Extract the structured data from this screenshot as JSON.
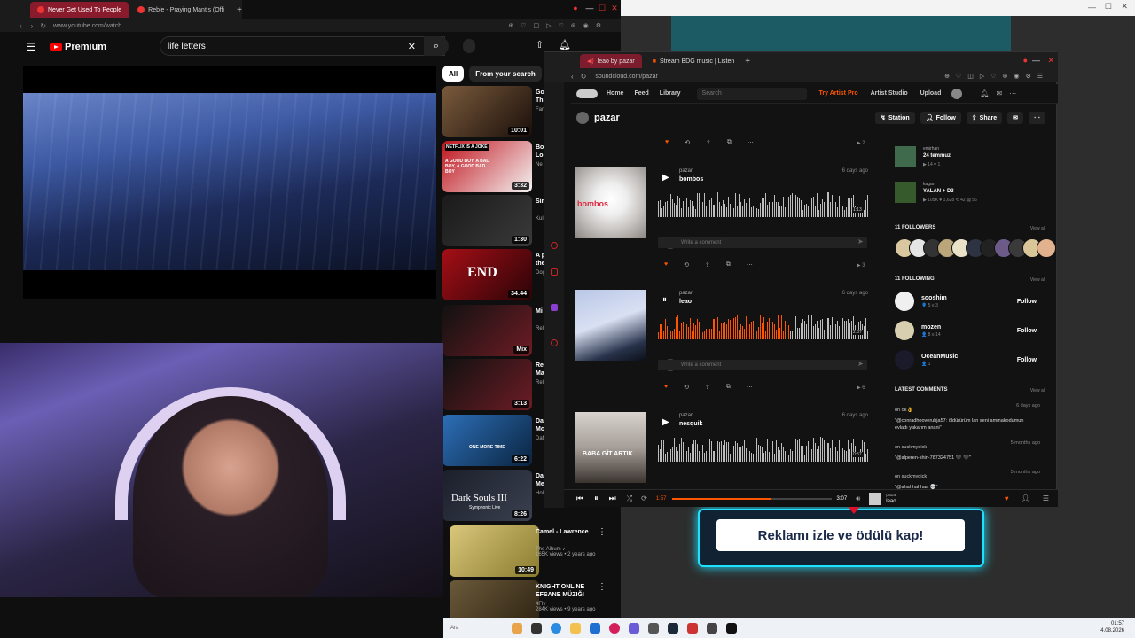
{
  "yt_browser": {
    "tabs": [
      "Never Get Used To People",
      "Reble - Praying Mantis (Offi"
    ],
    "url": "www.youtube.com/watch",
    "logo": "Premium",
    "search_value": "life letters",
    "chips": [
      "All",
      "From your search",
      "F"
    ],
    "recs": [
      {
        "title": "Go\nTh",
        "meta": "Far",
        "duration": "10:01",
        "thumb_colors": [
          "#7a5a3c",
          "#1a0f0a"
        ]
      },
      {
        "title": "Bo\nLo",
        "meta": "Ne",
        "duration": "3:32",
        "thumb_colors": [
          "#c0131c",
          "#f4f4f4"
        ]
      },
      {
        "title": "Sir",
        "meta": "Kul",
        "duration": "1:30",
        "thumb_colors": [
          "#1a1a1a",
          "#3a3a3a"
        ]
      },
      {
        "title": "A p\nthe",
        "meta": "Dog",
        "duration": "34:44",
        "thumb_colors": [
          "#a50e16",
          "#2a0407"
        ]
      },
      {
        "title": "Mi",
        "meta": "Rel",
        "duration": "Mix",
        "thumb_colors": [
          "#111",
          "#6d1c24"
        ]
      },
      {
        "title": "Re\nMa",
        "meta": "Rel",
        "duration": "3:13",
        "thumb_colors": [
          "#111",
          "#6d1c24"
        ]
      },
      {
        "title": "Da\nMo",
        "meta": "Daf",
        "duration": "6:22",
        "thumb_colors": [
          "#2d6fb8",
          "#0a2440"
        ]
      },
      {
        "title": "Da\nMe",
        "meta": "Hol",
        "duration": "8:26",
        "thumb_colors": [
          "#1b1f2a",
          "#3b4050"
        ]
      },
      {
        "title": "Camel - Lawrence",
        "meta": "The Album ♪\n165K views • 2 years ago",
        "duration": "10:49",
        "thumb_colors": [
          "#d9c77c",
          "#8a7b2d"
        ]
      },
      {
        "title": "KNIGHT ONLINE EFSANE MÜZIĞI",
        "meta": "4Fly\n284K views • 9 years ago",
        "duration": "",
        "thumb_colors": [
          "#6b5a3a",
          "#2b2010"
        ]
      }
    ],
    "thumb_text": {
      "r1": "END",
      "r6": "ONE MORE TIME",
      "r7": "Dark Souls III",
      "r7b": "Symphonic Live",
      "r1top": "NETFLIX IS A JOKE",
      "r1sub": "A GOOD BOY, A BAD BOY, A GOOD BAD BOY"
    }
  },
  "soundcloud": {
    "tabs": [
      "leao by pazar",
      "Stream BDG music | Listen"
    ],
    "url": "soundcloud.com/pazar",
    "nav": [
      "Home",
      "Feed",
      "Library"
    ],
    "search_placeholder": "Search",
    "try_pro": "Try Artist Pro",
    "artist_studio": "Artist Studio",
    "upload": "Upload",
    "profile_name": "pazar",
    "buttons": {
      "station": "Station",
      "follow": "Follow",
      "share": "Share"
    },
    "tracks": [
      {
        "user": "pazar",
        "title": "bombos",
        "ago": "6 days ago",
        "time": "1:13",
        "art_text": "bombos",
        "plays": "3"
      },
      {
        "user": "pazar",
        "title": "leao",
        "ago": "6 days ago",
        "time": "2:37",
        "elapsed": "1:57",
        "art_text": "",
        "plays": "6"
      },
      {
        "user": "pazar",
        "title": "nesquik",
        "ago": "6 days ago",
        "time": "0:57",
        "art_text": "BABA GİT ARTIK",
        "plays": ""
      }
    ],
    "top_plays": "2",
    "comment_placeholder": "Write a comment",
    "sidebar": {
      "reposts": [
        {
          "user": "emirhan",
          "title": "24 temmuz",
          "stats": "▶ 14 ♥ 1"
        },
        {
          "user": "kagan",
          "title": "YALAN + D3",
          "stats": "▶ 105K ♥ 1,628 ⟲ 42 ▤ 56"
        }
      ],
      "followers_h": "11 FOLLOWERS",
      "following_h": "11 FOLLOWING",
      "view_all": "View all",
      "following": [
        {
          "name": "sooshim",
          "stats": "👤 5  ≡ 3",
          "btn": "Follow"
        },
        {
          "name": "mozen",
          "stats": "👤 8  ≡ 14",
          "btn": "Follow"
        },
        {
          "name": "OceanMusic",
          "stats": "👤 1",
          "btn": "Follow"
        }
      ],
      "comments_h": "LATEST COMMENTS",
      "comments": [
        {
          "meta": "on ok👌",
          "ago": "6 days ago",
          "text": "\"@conradhooverubja57: öldürürüm lan seni amınakodumun evladı yakarım anani\""
        },
        {
          "meta": "on suckmydick",
          "ago": "5 months ago",
          "text": "\"@alperen-shin-787324751 🖤 🖤\""
        },
        {
          "meta": "on suckmydick",
          "ago": "5 months ago",
          "text": "\"@ahahhahhaa 💀\""
        }
      ]
    },
    "player": {
      "elapsed": "1:57",
      "total": "3:07",
      "user": "pazar",
      "title": "leao",
      "progress": 0.62
    },
    "playing_progress": 0.62
  },
  "bg_window": {
    "ad_text": "Reklamı izle ve ödülü kap!"
  },
  "taskbar": {
    "time": "01:57",
    "date": "4.08.2026"
  },
  "colors": {
    "sc_orange": "#ff5500",
    "yt_red": "#ff0000",
    "accent_teal": "#1ee0ff"
  }
}
